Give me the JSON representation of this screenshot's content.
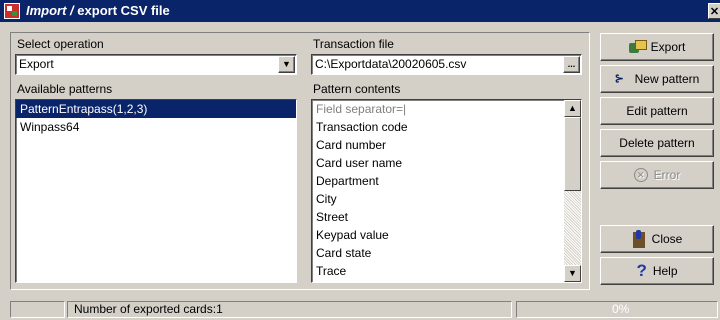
{
  "window": {
    "title_italic": "Import /",
    "title_rest": "export CSV file",
    "close_glyph": "✕"
  },
  "left": {
    "select_operation_label": "Select operation",
    "operation_value": "Export",
    "available_patterns_label": "Available patterns",
    "patterns": [
      {
        "label": "PatternEntrapass(1,2,3)",
        "selected": true
      },
      {
        "label": "Winpass64",
        "selected": false
      }
    ]
  },
  "middle": {
    "transaction_file_label": "Transaction file",
    "transaction_file_value": "C:\\Exportdata\\20020605.csv",
    "browse_label": "...",
    "pattern_contents_label": "Pattern contents",
    "pattern_contents": [
      "Field separator=|",
      "Transaction code",
      "Card number",
      "Card user name",
      "Department",
      "City",
      "Street",
      "Keypad value",
      "Card state",
      "Trace"
    ]
  },
  "buttons": {
    "export": "Export",
    "new_pattern": "New pattern",
    "edit_pattern": "Edit pattern",
    "delete_pattern": "Delete pattern",
    "error": "Error",
    "close": "Close",
    "help": "Help"
  },
  "icons": {
    "export": "export-icon",
    "new_pattern": "new-pattern-icon",
    "error": "error-icon",
    "close": "close-door-icon",
    "help": "help-question-icon",
    "dropdown": "chevron-down-icon",
    "scroll_up": "scroll-up-arrow-icon",
    "scroll_down": "scroll-down-arrow-icon"
  },
  "status": {
    "exported_cards": "Number of exported cards:1",
    "progress_text": "0%",
    "progress_value": 0
  },
  "colors": {
    "title_bar": "#0a246a",
    "selection": "#0a246a",
    "face": "#d4d0c8"
  }
}
